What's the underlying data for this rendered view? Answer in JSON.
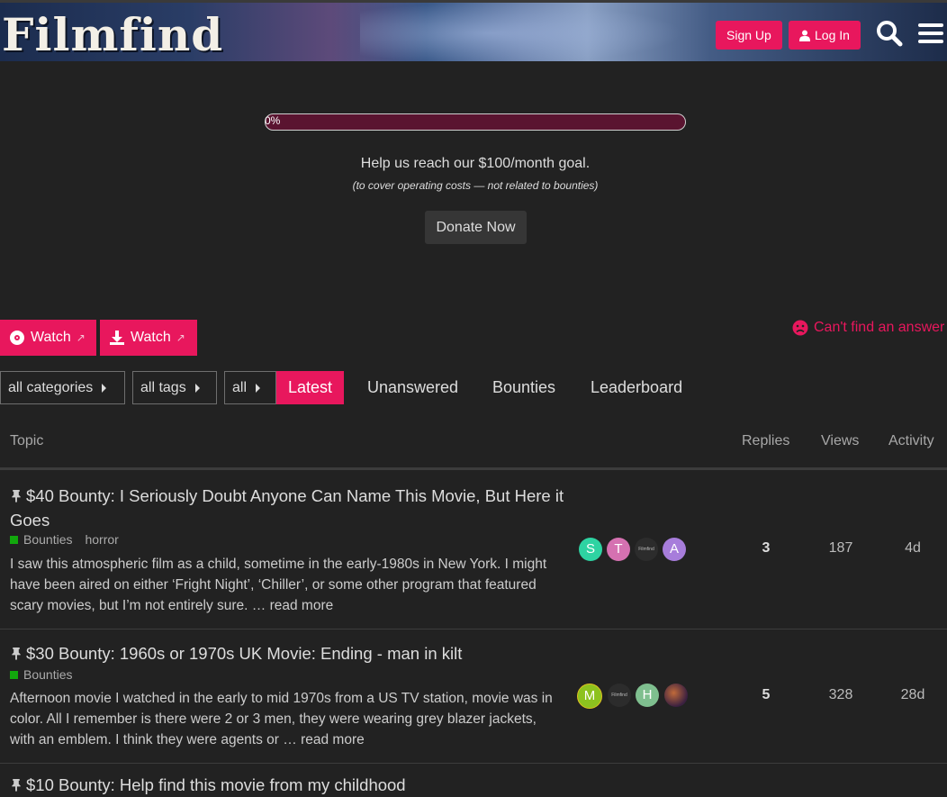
{
  "header": {
    "logo_text": "Filmfind",
    "signup_label": "Sign Up",
    "login_label": "Log In"
  },
  "donation": {
    "progress_label": "0%",
    "progress_value": 0,
    "goal_text": "Help us reach our $100/month goal.",
    "goal_subtext": "(to cover operating costs — not related to bounties)",
    "donate_label": "Donate Now"
  },
  "actions": {
    "watch1_label": "Watch",
    "watch2_label": "Watch",
    "external_glyph": "↗",
    "cant_find_label": "Can't find an answer"
  },
  "nav": {
    "categories_label": "all categories",
    "tags_label": "all tags",
    "all_label": "all",
    "tabs": [
      {
        "label": "Latest",
        "active": true
      },
      {
        "label": "Unanswered",
        "active": false
      },
      {
        "label": "Bounties",
        "active": false
      },
      {
        "label": "Leaderboard",
        "active": false
      }
    ]
  },
  "table": {
    "headers": {
      "topic": "Topic",
      "replies": "Replies",
      "views": "Views",
      "activity": "Activity"
    },
    "rows": [
      {
        "title": "$40 Bounty: I Seriously Doubt Anyone Can Name This Movie, But Here it Goes",
        "category": "Bounties",
        "tag": "horror",
        "excerpt": "I saw this atmospheric film as a child, sometime in the early-1980s in New York. I might have been aired on either ‘Fright Night’, ‘Chiller’, or some other program that featured scary movies, but I’m not entirely sure. …",
        "read_more": "read more",
        "avatars": [
          {
            "letter": "S",
            "color": "#2ed3a2"
          },
          {
            "letter": "T",
            "color": "#d571b1"
          },
          {
            "letter": "Filmfind",
            "color": "#2c2c2c"
          },
          {
            "letter": "A",
            "color": "#a77ddb"
          }
        ],
        "replies": "3",
        "views": "187",
        "activity": "4d"
      },
      {
        "title": "$30 Bounty: 1960s or 1970s UK Movie: Ending - man in kilt",
        "category": "Bounties",
        "tag": "",
        "excerpt": "Afternoon movie I watched in the early to mid 1970s from a US TV station, movie was in color. All I remember is there were 2 or 3 men, they were wearing grey blazer jackets, with an emblem. I think they were agents or …",
        "read_more": "read more",
        "avatars": [
          {
            "letter": "M",
            "color": "#8dc21f"
          },
          {
            "letter": "Filmfind",
            "color": "#2c2c2c"
          },
          {
            "letter": "H",
            "color": "#7fbf8f"
          },
          {
            "letter": "",
            "color": "#6a3a2a"
          }
        ],
        "replies": "5",
        "views": "328",
        "activity": "28d"
      },
      {
        "title": "$10 Bounty: Help find this movie from my childhood",
        "category": "",
        "tag": "",
        "excerpt": "",
        "read_more": "",
        "avatars": [],
        "replies": "",
        "views": "",
        "activity": ""
      }
    ]
  },
  "colors": {
    "accent": "#e8175d",
    "background": "#222222",
    "category_bounties": "#12a80d"
  }
}
